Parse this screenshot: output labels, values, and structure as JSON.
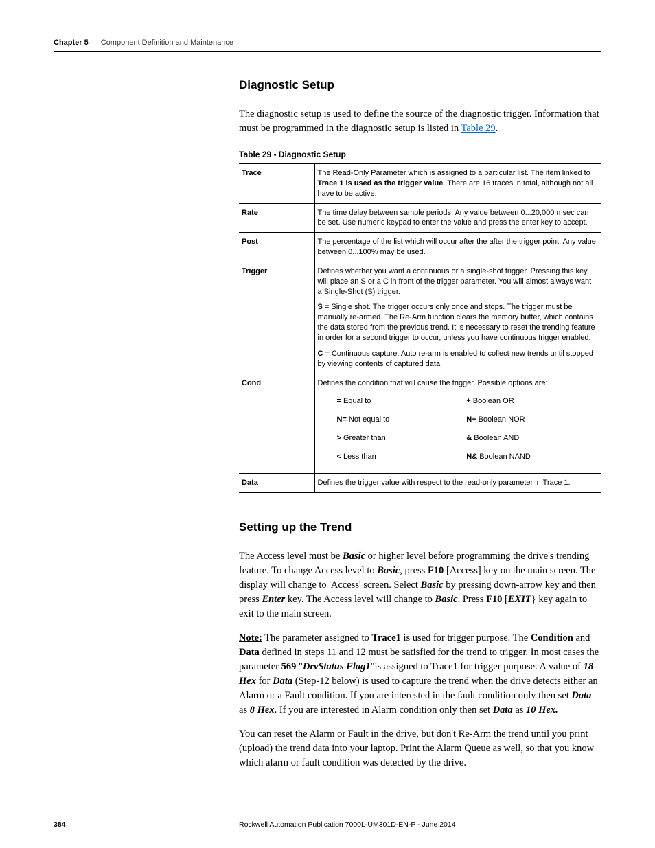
{
  "header": {
    "chapter_label": "Chapter 5",
    "chapter_title": "Component Definition and Maintenance"
  },
  "section1": {
    "title": "Diagnostic Setup",
    "intro_pre": "The diagnostic setup is used to define the source of the diagnostic trigger. Information that must be programmed in the diagnostic setup is listed in ",
    "intro_link": "Table 29",
    "intro_post": "."
  },
  "table29": {
    "caption": "Table 29 - Diagnostic Setup",
    "rows": {
      "trace": {
        "label": "Trace",
        "pre": "The Read-Only Parameter which is assigned to a particular list. The item linked to ",
        "bold": "Trace 1 is used as the trigger value",
        "post": ".  There are 16 traces in total, although not all have to be active."
      },
      "rate": {
        "label": "Rate",
        "text": "The time delay between sample periods. Any value between 0...20,000 msec can be set. Use numeric keypad to enter the value and press the enter key to accept."
      },
      "post": {
        "label": "Post",
        "text": "The percentage of the list which will occur after the after the trigger point. Any value between 0...100% may be used."
      },
      "trigger": {
        "label": "Trigger",
        "p1": "Defines whether you want a continuous or a single-shot trigger. Pressing this key will place an S or a C in front of the trigger parameter. You will almost always want a Single-Shot (S) trigger.",
        "p2_b": "S",
        "p2_rest": " = Single shot. The trigger occurs only once and stops. The trigger must be manually re-armed. The Re-Arm function clears the memory buffer, which contains the data stored from the previous trend. It is necessary to reset the trending feature in order for a second trigger to occur, unless you have continuous trigger enabled.",
        "p3_b": "C",
        "p3_rest": " = Continuous capture. Auto re-arm is enabled to collect new trends until stopped by viewing contents of captured data."
      },
      "cond": {
        "label": "Cond",
        "intro": "Defines the condition that will cause the trigger. Possible options are:",
        "items": [
          {
            "sym": "=",
            "txt": " Equal to"
          },
          {
            "sym": "+",
            "txt": " Boolean OR"
          },
          {
            "sym": "N=",
            "txt": " Not equal to"
          },
          {
            "sym": "N+",
            "txt": " Boolean NOR"
          },
          {
            "sym": ">",
            "txt": " Greater than"
          },
          {
            "sym": "&",
            "txt": " Boolean AND"
          },
          {
            "sym": "<",
            "txt": " Less than"
          },
          {
            "sym": "N&",
            "txt": " Boolean NAND"
          }
        ]
      },
      "data": {
        "label": "Data",
        "text": "Defines the trigger value with respect to the read-only parameter in Trace 1."
      }
    }
  },
  "section2": {
    "title": "Setting up the Trend",
    "p1": {
      "s1": "The Access level must be ",
      "b1": "Basic",
      "s2": " or higher level before programming the drive's trending feature. To change Access level to ",
      "b2": "Basic",
      "s3": ", press ",
      "b3": "F10",
      "s4": " [Access] key on the main screen. The display will change to 'Access' screen. Select ",
      "b4": "Basic",
      "s5": " by pressing down-arrow key and then press ",
      "b5": "Enter",
      "s6": " key. The Access level will change to ",
      "b6": "Basic",
      "s7": ". Press ",
      "b7": "F10",
      "s8": " [",
      "b8": "EXIT",
      "s9": "} key again to exit to the main screen."
    },
    "p2": {
      "note": "Note:",
      "s1": " The parameter assigned to ",
      "b1": "Trace1",
      "s2": " is used for trigger purpose. The ",
      "b2": "Condition",
      "s3": " and ",
      "b3": "Data",
      "s4": " defined in steps 11 and 12 must be satisfied for the trend to trigger. In most cases the parameter ",
      "b4": "569",
      "s5": " \"",
      "bi1": "DrvStatus Flag1",
      "s6": "\"is assigned to Trace1 for trigger purpose. A value of ",
      "bi2": "18 Hex",
      "s7": " for ",
      "bi3": "Data",
      "s8": " (Step-12 below) is used to capture the trend when the drive detects either an Alarm or a Fault condition. If you are interested in the fault condition only then set ",
      "bi4": "Data",
      "s9": " as ",
      "bi5": "8 Hex",
      "s10": ". If you are interested in Alarm condition only then set ",
      "bi6": "Data",
      "s11": " as ",
      "bi7": "10 Hex."
    },
    "p3": "You can reset the Alarm or Fault in the drive, but don't Re-Arm the trend until you print (upload) the trend data into your laptop. Print the Alarm Queue as well, so that you know which alarm or fault condition was detected by the drive."
  },
  "footer": {
    "page": "384",
    "pub": "Rockwell Automation Publication 7000L-UM301D-EN-P - June 2014"
  }
}
